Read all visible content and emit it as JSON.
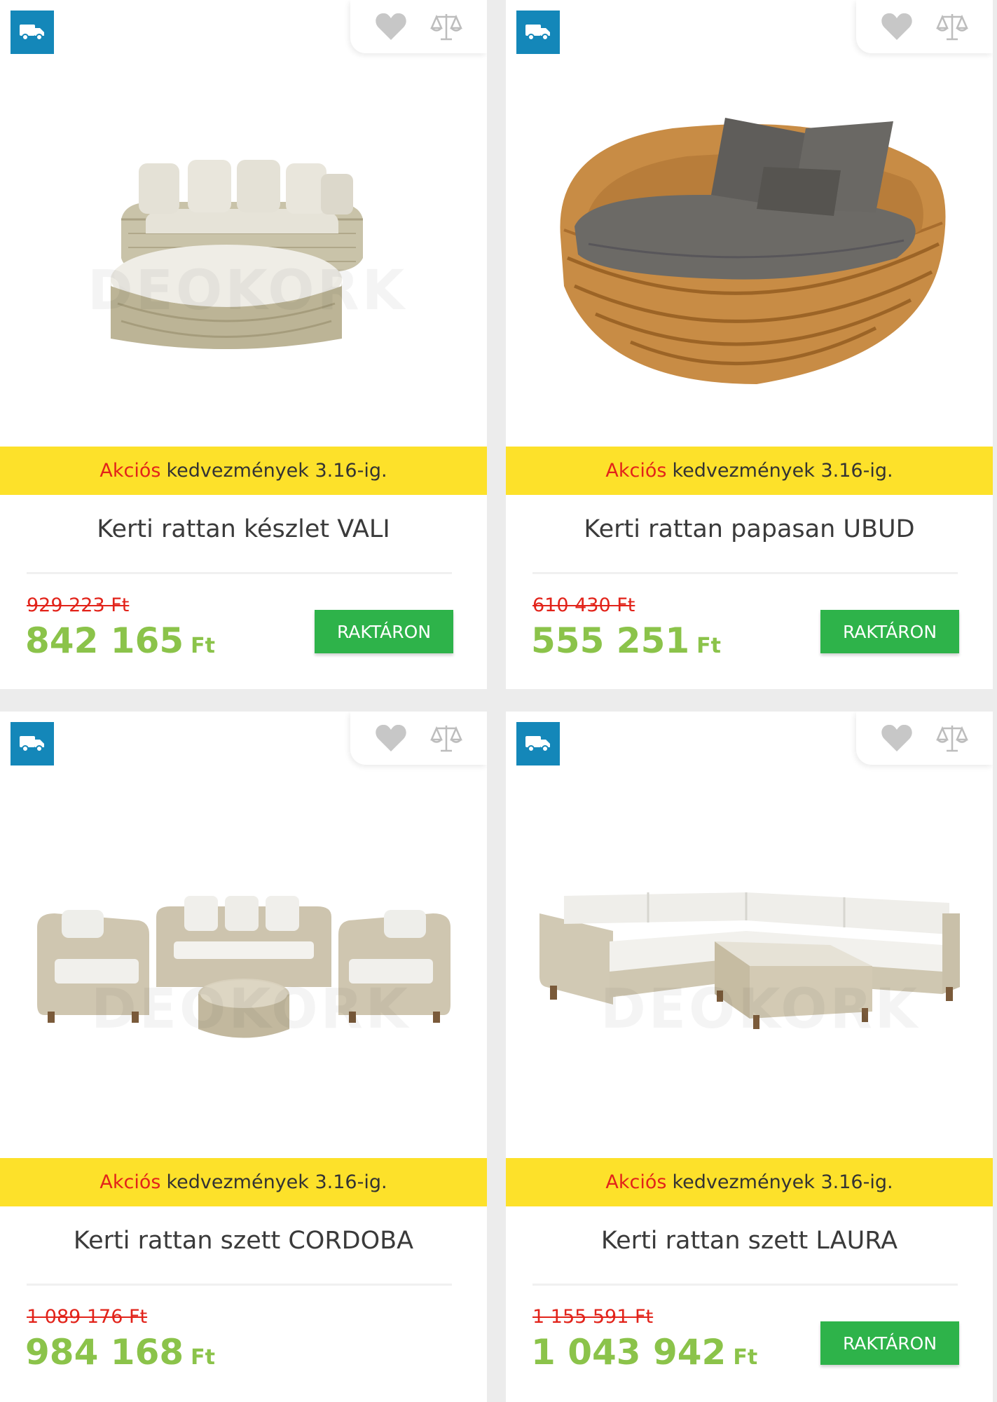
{
  "colors": {
    "promo_bg": "#fde12a",
    "promo_highlight": "#e2231a",
    "old_price": "#e2231a",
    "new_price": "#8bc34a",
    "stock_button": "#2eb34a",
    "delivery_badge": "#1487b9"
  },
  "icons": {
    "delivery": "truck-icon",
    "wishlist": "heart-icon",
    "compare": "scale-icon"
  },
  "products": [
    {
      "promo_highlight": "Akciós",
      "promo_text": "kedvezmények 3.16-ig.",
      "title": "Kerti rattan készlet VALI",
      "old_price": "929 223 Ft",
      "new_price": "842 165",
      "currency": "Ft",
      "stock_label": "RAKTÁRON",
      "watermark": "DEOKORK"
    },
    {
      "promo_highlight": "Akciós",
      "promo_text": "kedvezmények 3.16-ig.",
      "title": "Kerti rattan papasan UBUD",
      "old_price": "610 430 Ft",
      "new_price": "555 251",
      "currency": "Ft",
      "stock_label": "RAKTÁRON",
      "watermark": ""
    },
    {
      "promo_highlight": "Akciós",
      "promo_text": "kedvezmények 3.16-ig.",
      "title": "Kerti rattan szett CORDOBA",
      "old_price": "1 089 176 Ft",
      "new_price": "984 168",
      "currency": "Ft",
      "stock_label": "",
      "watermark": "DEOKORK"
    },
    {
      "promo_highlight": "Akciós",
      "promo_text": "kedvezmények 3.16-ig.",
      "title": "Kerti rattan szett LAURA",
      "old_price": "1 155 591 Ft",
      "new_price": "1 043 942",
      "currency": "Ft",
      "stock_label": "RAKTÁRON",
      "watermark": "DEOKORK"
    }
  ]
}
